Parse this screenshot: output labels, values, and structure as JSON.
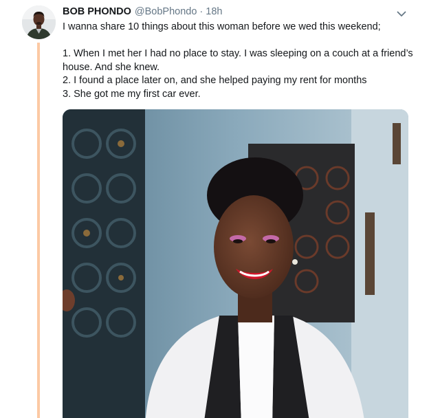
{
  "tweet": {
    "display_name": "BOB PHONDO",
    "handle": "@BobPhondo",
    "separator": "·",
    "time": "18h",
    "avatar_icon": "avatar-photo",
    "menu_icon": "chevron-down-icon",
    "lines": [
      "I wanna share 10 things about this woman before we wed this weekend;",
      "",
      "1. When I met her I had no place to stay. I was sleeping on a couch at a friend’s house. And she knew.",
      "2. I found a place later on, and she helped paying my rent for months",
      "3. She got me my first car ever."
    ],
    "media": {
      "kind": "photo",
      "subject": "woman-in-white-tuxedo-jacket"
    }
  },
  "colors": {
    "thread_line": "#fcc9a4",
    "name": "#14171a",
    "secondary": "#657786"
  }
}
